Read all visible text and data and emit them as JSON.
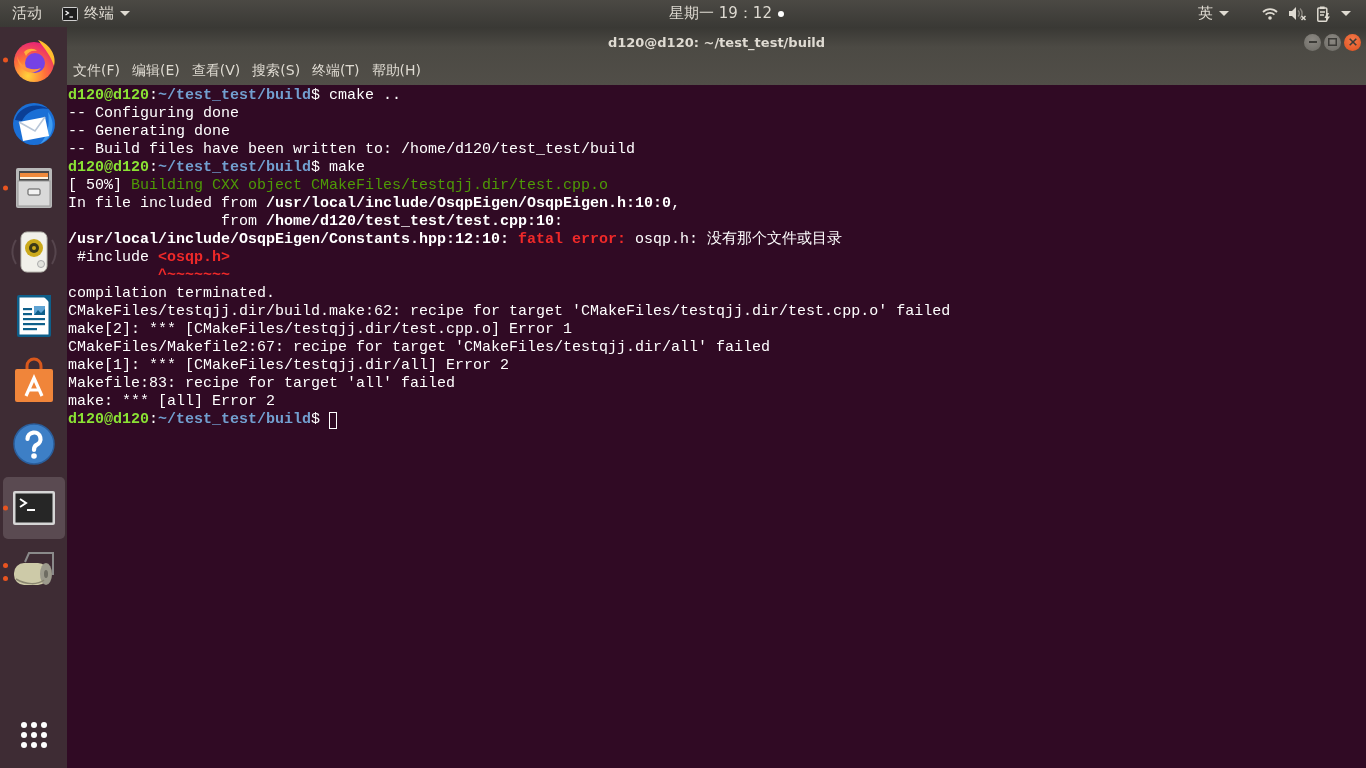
{
  "top_bar": {
    "activities": "活动",
    "app_menu": {
      "label": "终端"
    },
    "clock": {
      "text": "星期一 19：12",
      "notification": true
    },
    "input_method": {
      "label": "英"
    },
    "status_menu": {
      "muted": true
    }
  },
  "dock": {
    "items": [
      {
        "kind": "browser",
        "running": true,
        "multiple_windows": false,
        "selected": false
      },
      {
        "kind": "mail",
        "running": false,
        "multiple_windows": false,
        "selected": false
      },
      {
        "kind": "files",
        "running": true,
        "multiple_windows": false,
        "selected": false
      },
      {
        "kind": "music",
        "running": false,
        "multiple_windows": false,
        "selected": false
      },
      {
        "kind": "writer",
        "running": false,
        "multiple_windows": false,
        "selected": false
      },
      {
        "kind": "store",
        "running": false,
        "multiple_windows": false,
        "selected": false
      },
      {
        "kind": "help",
        "running": false,
        "multiple_windows": false,
        "selected": false
      },
      {
        "kind": "terminal",
        "running": true,
        "multiple_windows": false,
        "selected": true
      },
      {
        "kind": "roller",
        "running": true,
        "multiple_windows": true,
        "selected": false
      }
    ]
  },
  "window": {
    "title": "d120@d120: ~/test_test/build",
    "menu": [
      "文件(F)",
      "编辑(E)",
      "查看(V)",
      "搜索(S)",
      "终端(T)",
      "帮助(H)"
    ],
    "terminal": {
      "lines": [
        {
          "segments": [
            {
              "text": "d120@d120",
              "kind": "user"
            },
            {
              "text": ":",
              "kind": "plain"
            },
            {
              "text": "~/test_test/build",
              "kind": "path"
            },
            {
              "text": "$ cmake ..",
              "kind": "plain"
            }
          ]
        },
        {
          "segments": [
            {
              "text": "-- Configuring done",
              "kind": "plain"
            }
          ]
        },
        {
          "segments": [
            {
              "text": "-- Generating done",
              "kind": "plain"
            }
          ]
        },
        {
          "segments": [
            {
              "text": "-- Build files have been written to: /home/d120/test_test/build",
              "kind": "plain"
            }
          ]
        },
        {
          "segments": [
            {
              "text": "d120@d120",
              "kind": "user"
            },
            {
              "text": ":",
              "kind": "plain"
            },
            {
              "text": "~/test_test/build",
              "kind": "path"
            },
            {
              "text": "$ make",
              "kind": "plain"
            }
          ]
        },
        {
          "segments": [
            {
              "text": "[ 50%] ",
              "kind": "plain"
            },
            {
              "text": "Building CXX object CMakeFiles/testqjj.dir/test.cpp.o",
              "kind": "green"
            }
          ]
        },
        {
          "segments": [
            {
              "text": "In file included from ",
              "kind": "plain"
            },
            {
              "text": "/usr/local/include/OsqpEigen/OsqpEigen.h:10:0",
              "kind": "bold"
            },
            {
              "text": ",",
              "kind": "plain"
            }
          ]
        },
        {
          "segments": [
            {
              "text": "                 from ",
              "kind": "plain"
            },
            {
              "text": "/home/d120/test_test/test.cpp:10",
              "kind": "bold"
            },
            {
              "text": ":",
              "kind": "plain"
            }
          ]
        },
        {
          "segments": [
            {
              "text": "/usr/local/include/OsqpEigen/Constants.hpp:12:10: ",
              "kind": "bold"
            },
            {
              "text": "fatal error:",
              "kind": "error"
            },
            {
              "text": " osqp.h: 没有那个文件或目录",
              "kind": "plain"
            }
          ]
        },
        {
          "segments": [
            {
              "text": " #include ",
              "kind": "plain"
            },
            {
              "text": "<osqp.h>",
              "kind": "error"
            }
          ]
        },
        {
          "segments": [
            {
              "text": "          ^~~~~~~~",
              "kind": "error"
            }
          ]
        },
        {
          "segments": [
            {
              "text": "compilation terminated.",
              "kind": "plain"
            }
          ]
        },
        {
          "segments": [
            {
              "text": "CMakeFiles/testqjj.dir/build.make:62: recipe for target 'CMakeFiles/testqjj.dir/test.cpp.o' failed",
              "kind": "plain"
            }
          ]
        },
        {
          "segments": [
            {
              "text": "make[2]: *** [CMakeFiles/testqjj.dir/test.cpp.o] Error 1",
              "kind": "plain"
            }
          ]
        },
        {
          "segments": [
            {
              "text": "CMakeFiles/Makefile2:67: recipe for target 'CMakeFiles/testqjj.dir/all' failed",
              "kind": "plain"
            }
          ]
        },
        {
          "segments": [
            {
              "text": "make[1]: *** [CMakeFiles/testqjj.dir/all] Error 2",
              "kind": "plain"
            }
          ]
        },
        {
          "segments": [
            {
              "text": "Makefile:83: recipe for target 'all' failed",
              "kind": "plain"
            }
          ]
        },
        {
          "segments": [
            {
              "text": "make: *** [all] Error 2",
              "kind": "plain"
            }
          ]
        }
      ],
      "input_line": {
        "segments": [
          {
            "text": "d120@d120",
            "kind": "user"
          },
          {
            "text": ":",
            "kind": "plain"
          },
          {
            "text": "~/test_test/build",
            "kind": "path"
          },
          {
            "text": "$ ",
            "kind": "plain"
          }
        ],
        "cursor": true
      }
    }
  }
}
